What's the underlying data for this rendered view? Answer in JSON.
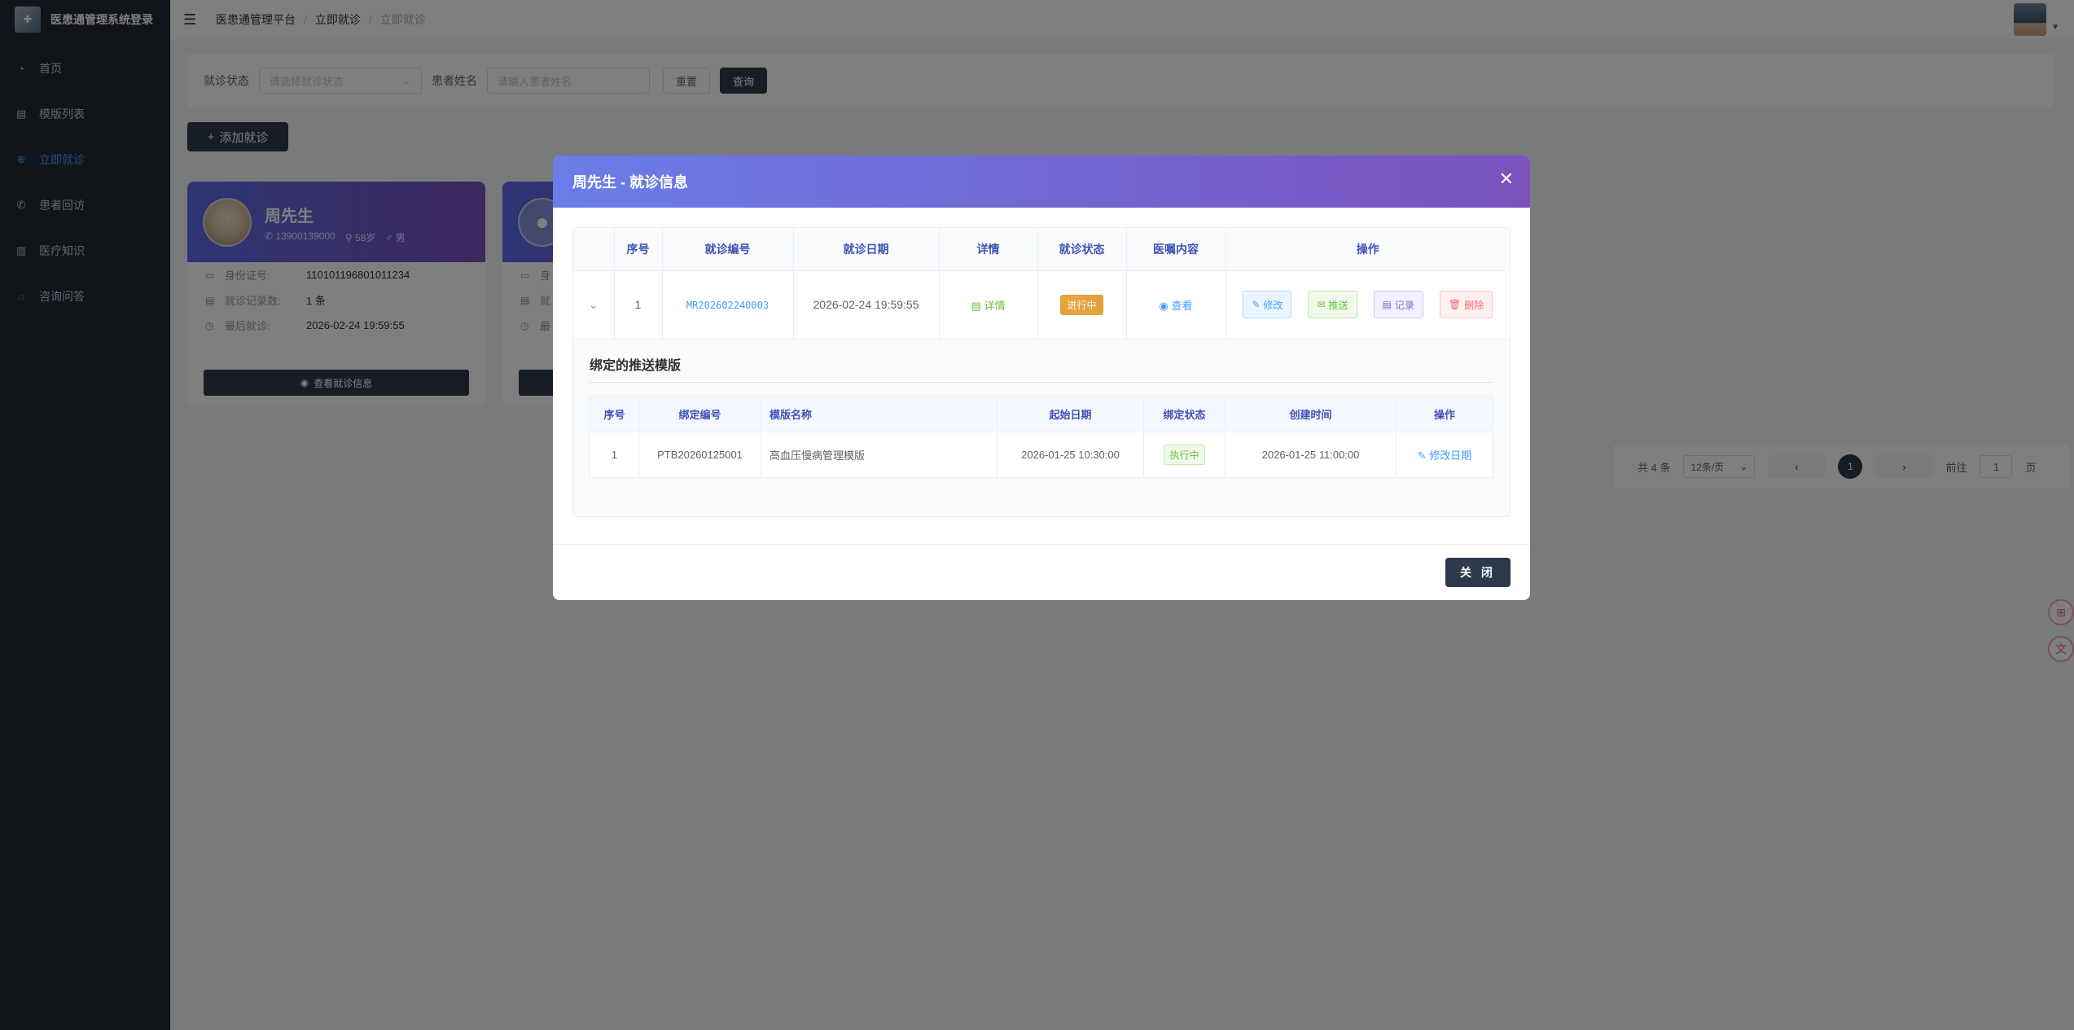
{
  "app": {
    "brand_title": "医患通管理系统登录",
    "breadcrumb": [
      "医患通管理平台",
      "立即就诊",
      "立即就诊"
    ]
  },
  "sidebar": {
    "items": [
      {
        "label": "首页",
        "icon": "dashboard-icon"
      },
      {
        "label": "模版列表",
        "icon": "document-icon"
      },
      {
        "label": "立即就诊",
        "icon": "medical-icon",
        "active": true
      },
      {
        "label": "患者回访",
        "icon": "phone-icon"
      },
      {
        "label": "医疗知识",
        "icon": "book-icon"
      },
      {
        "label": "咨询问答",
        "icon": "chat-icon"
      }
    ]
  },
  "filter": {
    "status_label": "就诊状态",
    "status_placeholder": "请选择就诊状态",
    "name_label": "患者姓名",
    "name_placeholder": "请输入患者姓名",
    "reset_label": "重置",
    "query_label": "查询"
  },
  "add_button": "添加就诊",
  "patient_card": {
    "name": "周先生",
    "phone": "13900139000",
    "age": "58岁",
    "gender": "男",
    "id_label": "身份证号:",
    "id_value": "110101196801011234",
    "records_label": "就诊记录数:",
    "records_value": "1 条",
    "last_label": "最后就诊:",
    "last_value": "2026-02-24 19:59:55",
    "view_button": "查看就诊信息"
  },
  "patient_card2_fragments": [
    "身",
    "就",
    "最"
  ],
  "pager": {
    "total": "共 4 条",
    "size": "12条/页",
    "current": "1",
    "goto_label": "前往",
    "goto_value": "1",
    "page_suffix": "页"
  },
  "dialog": {
    "title": "周先生 - 就诊信息",
    "close_button": "关 闭",
    "columns": [
      "序号",
      "就诊编号",
      "就诊日期",
      "详情",
      "就诊状态",
      "医嘱内容",
      "操作"
    ],
    "row": {
      "index": "1",
      "code": "MR202602240003",
      "date": "2026-02-24 19:59:55",
      "detail": "详情",
      "status": "进行中",
      "advice": "查看",
      "actions": [
        "修改",
        "推送",
        "记录",
        "删除"
      ]
    },
    "sub_title": "绑定的推送模版",
    "sub_columns": [
      "序号",
      "绑定编号",
      "模版名称",
      "起始日期",
      "绑定状态",
      "创建时间",
      "操作"
    ],
    "sub_row": {
      "index": "1",
      "code": "PTB20260125001",
      "name": "高血压慢病管理模版",
      "start": "2026-01-25 10:30:00",
      "status": "执行中",
      "created": "2026-01-25 11:00:00",
      "action": "修改日期"
    }
  },
  "colors": {
    "sidebar_bg": "#232a35",
    "accent": "#409eff",
    "dark_button": "#2d3a4b",
    "header_gradient_start": "#6a7de8",
    "header_gradient_end": "#7a52bc"
  }
}
